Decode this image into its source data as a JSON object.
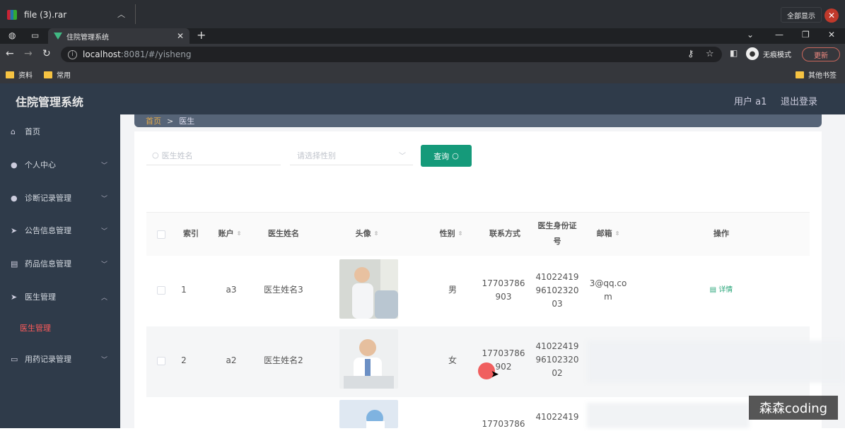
{
  "download_bar": {
    "file_name": "file (3).rar",
    "show_all": "全部显示"
  },
  "browser": {
    "tab_title": "住院管理系统",
    "url_host": "localhost",
    "url_rest": ":8081/#/yisheng",
    "incognito": "无痕模式",
    "update": "更新"
  },
  "bookmarks": {
    "items": [
      "资料",
      "常用"
    ],
    "other": "其他书签"
  },
  "app": {
    "title": "住院管理系统",
    "user": "用户 a1",
    "logout": "退出登录"
  },
  "sidebar": {
    "items": [
      {
        "label": "首页",
        "icon": "home-icon"
      },
      {
        "label": "个人中心",
        "icon": "user-icon"
      },
      {
        "label": "诊断记录管理",
        "icon": "user-icon"
      },
      {
        "label": "公告信息管理",
        "icon": "send-icon"
      },
      {
        "label": "药品信息管理",
        "icon": "box-icon"
      },
      {
        "label": "医生管理",
        "icon": "send-icon"
      },
      {
        "label": "用药记录管理",
        "icon": "chat-icon"
      }
    ],
    "active_sub": "医生管理"
  },
  "breadcrumb": {
    "home": "首页",
    "sep": ">",
    "current": "医生"
  },
  "filters": {
    "name_placeholder": "医生姓名",
    "gender_placeholder": "请选择性别",
    "query": "查询"
  },
  "table": {
    "headers": [
      "索引",
      "账户",
      "医生姓名",
      "头像",
      "性别",
      "联系方式",
      "医生身份证号",
      "邮箱",
      "操作"
    ],
    "rows": [
      {
        "index": "1",
        "account": "a3",
        "name": "医生姓名3",
        "gender": "男",
        "phone_a": "17703786",
        "phone_b": "903",
        "id_a": "41022419",
        "id_b": "96102320",
        "id_c": "03",
        "email_a": "3@qq.co",
        "email_b": "m",
        "action": "详情"
      },
      {
        "index": "2",
        "account": "a2",
        "name": "医生姓名2",
        "gender": "女",
        "phone_a": "17703786",
        "phone_b": "902",
        "id_a": "41022419",
        "id_b": "96102320",
        "id_c": "02"
      },
      {
        "phone_a": "17703786",
        "id_a": "41022419"
      }
    ]
  },
  "watermark": "森森coding"
}
